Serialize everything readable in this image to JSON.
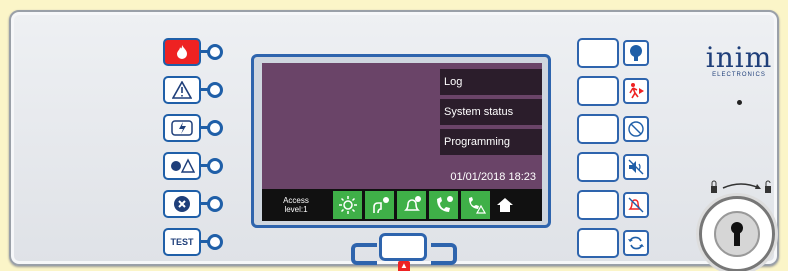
{
  "left_keys": [
    {
      "name": "fire",
      "label": "🔥",
      "icon": "fire-icon"
    },
    {
      "name": "fault",
      "label": "⚠",
      "icon": "warning-icon"
    },
    {
      "name": "power",
      "label": "⚡",
      "icon": "power-fault-icon"
    },
    {
      "name": "disable",
      "label": "✸⚠",
      "icon": "disablement-icon"
    },
    {
      "name": "mute",
      "label": "⊗",
      "icon": "cancel-icon"
    },
    {
      "name": "test",
      "label": "TEST",
      "icon": "test-icon"
    }
  ],
  "display": {
    "menu": [
      "Log",
      "System status",
      "Programming"
    ],
    "datetime": "01/01/2018 18:23",
    "access_line1": "Access",
    "access_line2": "level:1",
    "status_icons": [
      "sun-icon",
      "plug-ok-icon",
      "bell-ok-icon",
      "phone-ok-icon",
      "phone-fault-icon"
    ],
    "home_icon": "home-icon"
  },
  "right_keys": [
    {
      "icon": "info-icon",
      "glyph": "i"
    },
    {
      "icon": "evacuate-icon",
      "glyph": "🏃"
    },
    {
      "icon": "disable-icon",
      "glyph": "⊘"
    },
    {
      "icon": "silence-buzzer-icon",
      "glyph": "🔇"
    },
    {
      "icon": "silence-alarm-icon",
      "glyph": "🔕"
    },
    {
      "icon": "reset-icon",
      "glyph": "⟳"
    }
  ],
  "logo": {
    "word": "inim",
    "sub": "ELECTRONICS"
  },
  "colors": {
    "panel_bg": "#e5e8ec",
    "accent_blue": "#2e64ad",
    "screen_bg": "#6a4468",
    "status_green": "#3fb048",
    "fire_red": "#e22"
  }
}
